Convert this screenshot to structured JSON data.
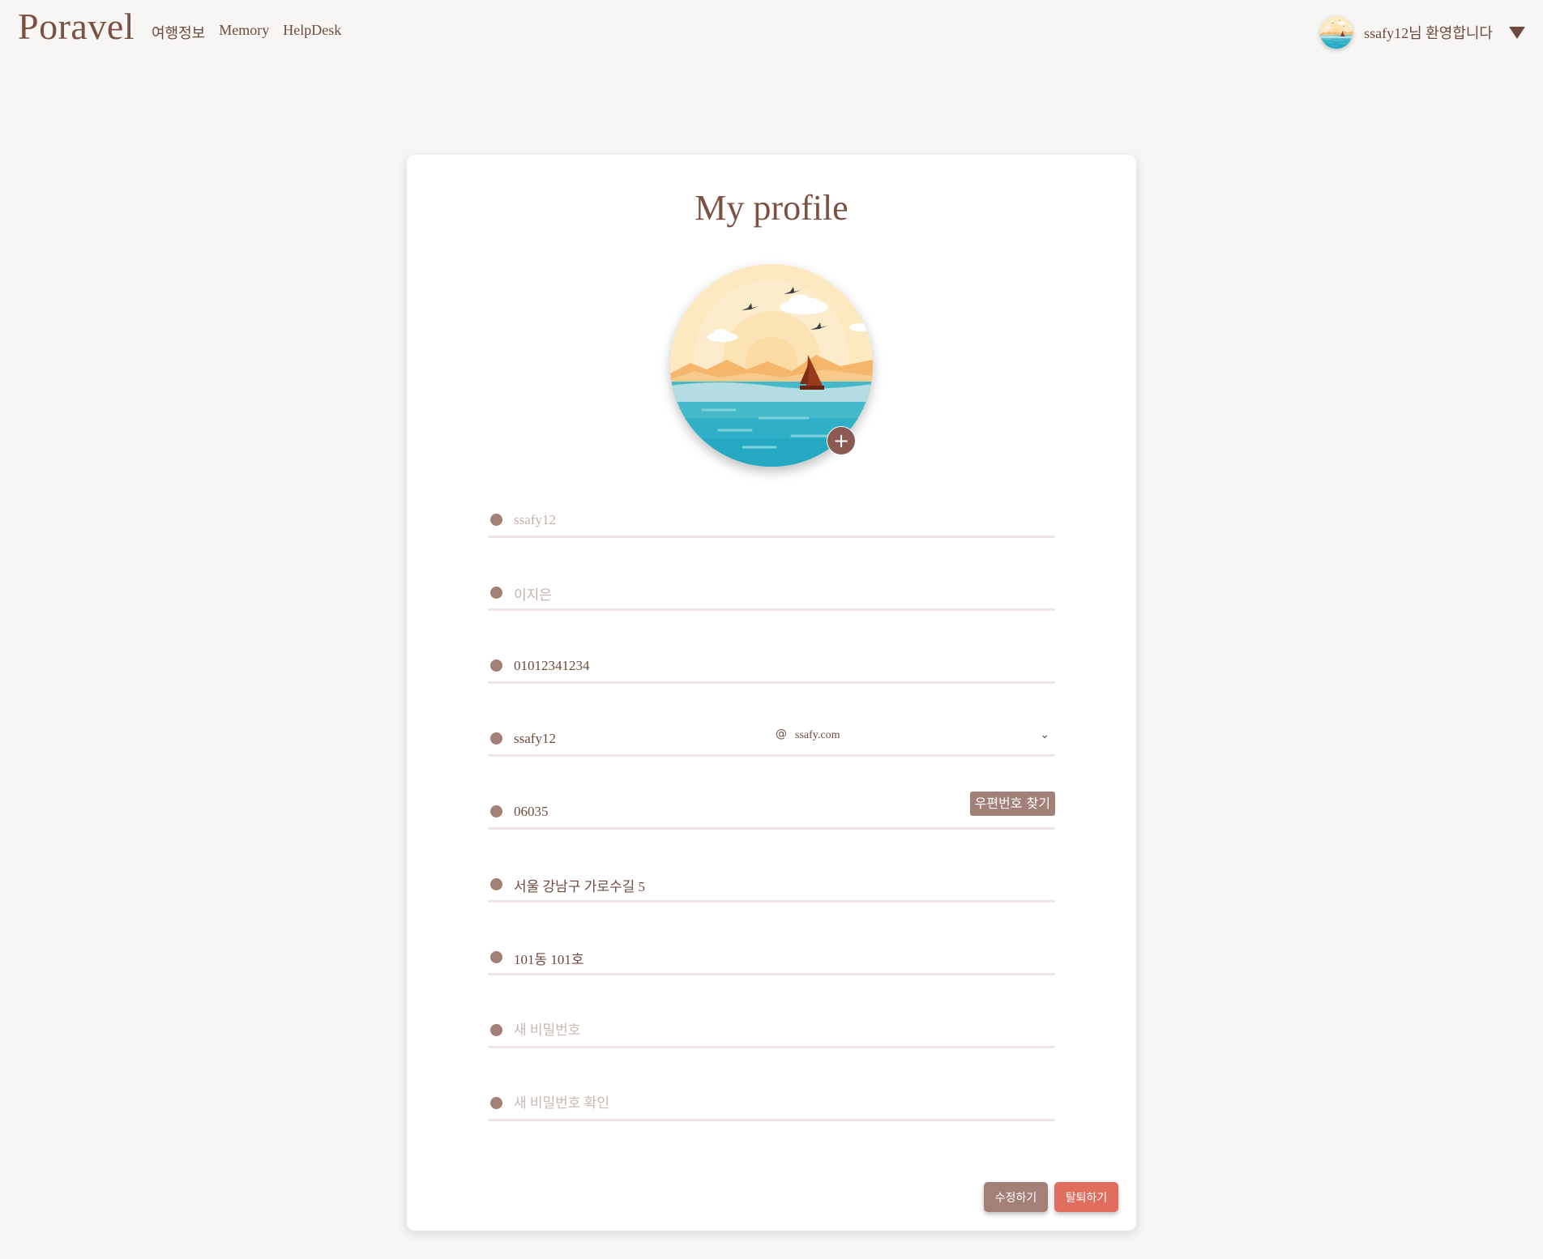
{
  "nav": {
    "logo": "Poravel",
    "links": [
      "여행정보",
      "Memory",
      "HelpDesk"
    ],
    "welcome": "ssafy12님 환영합니다",
    "avatar_icon": "beach-scene-avatar"
  },
  "profile": {
    "title": "My profile",
    "image_icon": "beach-sunset-illustration",
    "add_photo_label": "+",
    "id_value": "ssafy12",
    "name_value": "이지은",
    "phone_value": "01012341234",
    "email_local": "ssafy12",
    "email_at": "@",
    "email_domain": "ssafy.com",
    "zipcode": "06035",
    "zip_button": "우편번호 찾기",
    "address": "서울 강남구 가로수길 5",
    "address_detail": "101동 101호",
    "new_password_placeholder": "새 비밀번호",
    "confirm_password_placeholder": "새 비밀번호 확인"
  },
  "actions": {
    "edit_label": "수정하기",
    "leave_label": "탈퇴하기"
  },
  "colors": {
    "accent": "#a27f77",
    "danger": "#e06d5e",
    "text": "#6e4a3e",
    "background": "#f8f6f4"
  }
}
